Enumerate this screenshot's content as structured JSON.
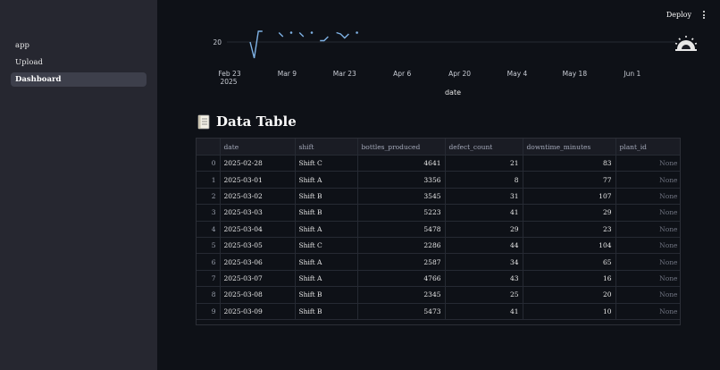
{
  "sidebar": {
    "items": [
      {
        "label": "app",
        "active": false
      },
      {
        "label": "Upload",
        "active": false
      },
      {
        "label": "Dashboard",
        "active": true
      }
    ]
  },
  "toolbar": {
    "deploy_label": "Deploy",
    "menu_icon": "kebab-menu-icon",
    "status_icon": "running-gear-icon"
  },
  "chart_data": {
    "type": "line",
    "xlabel": "date",
    "ylabel": "",
    "y_ticks": [
      "20"
    ],
    "x_ticks": [
      "Feb 23\n2025",
      "Mar 9",
      "Mar 23",
      "Apr 6",
      "Apr 20",
      "May 4",
      "May 18",
      "Jun 1"
    ],
    "series": [
      {
        "color": "#7fb2e5",
        "x": [
          "2025-02-28",
          "2025-03-01",
          "2025-03-02",
          "2025-03-03",
          "2025-03-04",
          "2025-03-05",
          "2025-03-06",
          "2025-03-07",
          "2025-03-08",
          "2025-03-09",
          "2025-03-10",
          "2025-03-11",
          "2025-03-12",
          "2025-03-13",
          "2025-03-14",
          "2025-03-15",
          "2025-03-16",
          "2025-03-17",
          "2025-03-18",
          "2025-03-19",
          "2025-03-20",
          "2025-03-21",
          "2025-03-22",
          "2025-03-23",
          "2025-03-24",
          "2025-03-25",
          "2025-03-26",
          "2025-03-27",
          "2025-03-28"
        ],
        "values": [
          20,
          8,
          28,
          28,
          null,
          null,
          null,
          27,
          24,
          null,
          27,
          null,
          27,
          24,
          null,
          27,
          null,
          21,
          21,
          24,
          null,
          27,
          26,
          23,
          26,
          null,
          27,
          null,
          null
        ]
      }
    ]
  },
  "section": {
    "title": "Data Table",
    "icon": "document-icon"
  },
  "table": {
    "columns": [
      "date",
      "shift",
      "bottles_produced",
      "defect_count",
      "downtime_minutes",
      "plant_id"
    ],
    "rows": [
      {
        "index": "0",
        "date": "2025-02-28",
        "shift": "Shift C",
        "bottles_produced": "4641",
        "defect_count": "21",
        "downtime_minutes": "83",
        "plant_id": "None"
      },
      {
        "index": "1",
        "date": "2025-03-01",
        "shift": "Shift A",
        "bottles_produced": "3356",
        "defect_count": "8",
        "downtime_minutes": "77",
        "plant_id": "None"
      },
      {
        "index": "2",
        "date": "2025-03-02",
        "shift": "Shift B",
        "bottles_produced": "3545",
        "defect_count": "31",
        "downtime_minutes": "107",
        "plant_id": "None"
      },
      {
        "index": "3",
        "date": "2025-03-03",
        "shift": "Shift B",
        "bottles_produced": "5223",
        "defect_count": "41",
        "downtime_minutes": "29",
        "plant_id": "None"
      },
      {
        "index": "4",
        "date": "2025-03-04",
        "shift": "Shift A",
        "bottles_produced": "5478",
        "defect_count": "29",
        "downtime_minutes": "23",
        "plant_id": "None"
      },
      {
        "index": "5",
        "date": "2025-03-05",
        "shift": "Shift C",
        "bottles_produced": "2286",
        "defect_count": "44",
        "downtime_minutes": "104",
        "plant_id": "None"
      },
      {
        "index": "6",
        "date": "2025-03-06",
        "shift": "Shift A",
        "bottles_produced": "2587",
        "defect_count": "34",
        "downtime_minutes": "65",
        "plant_id": "None"
      },
      {
        "index": "7",
        "date": "2025-03-07",
        "shift": "Shift A",
        "bottles_produced": "4766",
        "defect_count": "43",
        "downtime_minutes": "16",
        "plant_id": "None"
      },
      {
        "index": "8",
        "date": "2025-03-08",
        "shift": "Shift B",
        "bottles_produced": "2345",
        "defect_count": "25",
        "downtime_minutes": "20",
        "plant_id": "None"
      },
      {
        "index": "9",
        "date": "2025-03-09",
        "shift": "Shift B",
        "bottles_produced": "5473",
        "defect_count": "41",
        "downtime_minutes": "10",
        "plant_id": "None"
      }
    ]
  }
}
